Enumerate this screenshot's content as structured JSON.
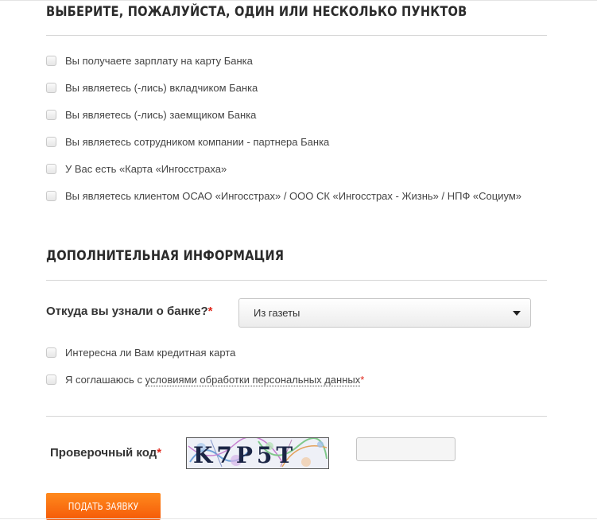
{
  "section1": {
    "title": "ВЫБЕРИТЕ, ПОЖАЛУЙСТА, ОДИН ИЛИ НЕСКОЛЬКО ПУНКТОВ",
    "options": [
      {
        "label": "Вы получаете зарплату на карту Банка",
        "checked": false
      },
      {
        "label": "Вы являетесь (-лись) вкладчиком Банка",
        "checked": false
      },
      {
        "label": "Вы являетесь (-лись) заемщиком Банка",
        "checked": false
      },
      {
        "label": "Вы являетесь сотрудником компании - партнера Банка",
        "checked": false
      },
      {
        "label": "У Вас есть «Карта «Ингосстраха»",
        "checked": false
      },
      {
        "label": "Вы являетесь клиентом ОСАО «Ингосстрах» / ООО СК «Ингосстрах - Жизнь» / НПФ «Социум»",
        "checked": false
      }
    ]
  },
  "section2": {
    "title": "ДОПОЛНИТЕЛЬНАЯ ИНФОРМАЦИЯ",
    "source": {
      "label": "Откуда вы узнали о банке?",
      "required_mark": "*",
      "selected": "Из газеты"
    },
    "credit_card": {
      "label": "Интересна ли Вам кредитная карта",
      "checked": false
    },
    "consent": {
      "prefix": "Я соглашаюсь с ",
      "link_text": "условиями обработки персональных данных",
      "required_mark": "*",
      "checked": false
    }
  },
  "captcha": {
    "label": "Проверочный код",
    "required_mark": "*",
    "code": "K7P5T",
    "input_value": ""
  },
  "submit": {
    "label": "ПОДАТЬ ЗАЯВКУ"
  },
  "colors": {
    "accent": "#f56a0c",
    "required": "#e0261b"
  }
}
